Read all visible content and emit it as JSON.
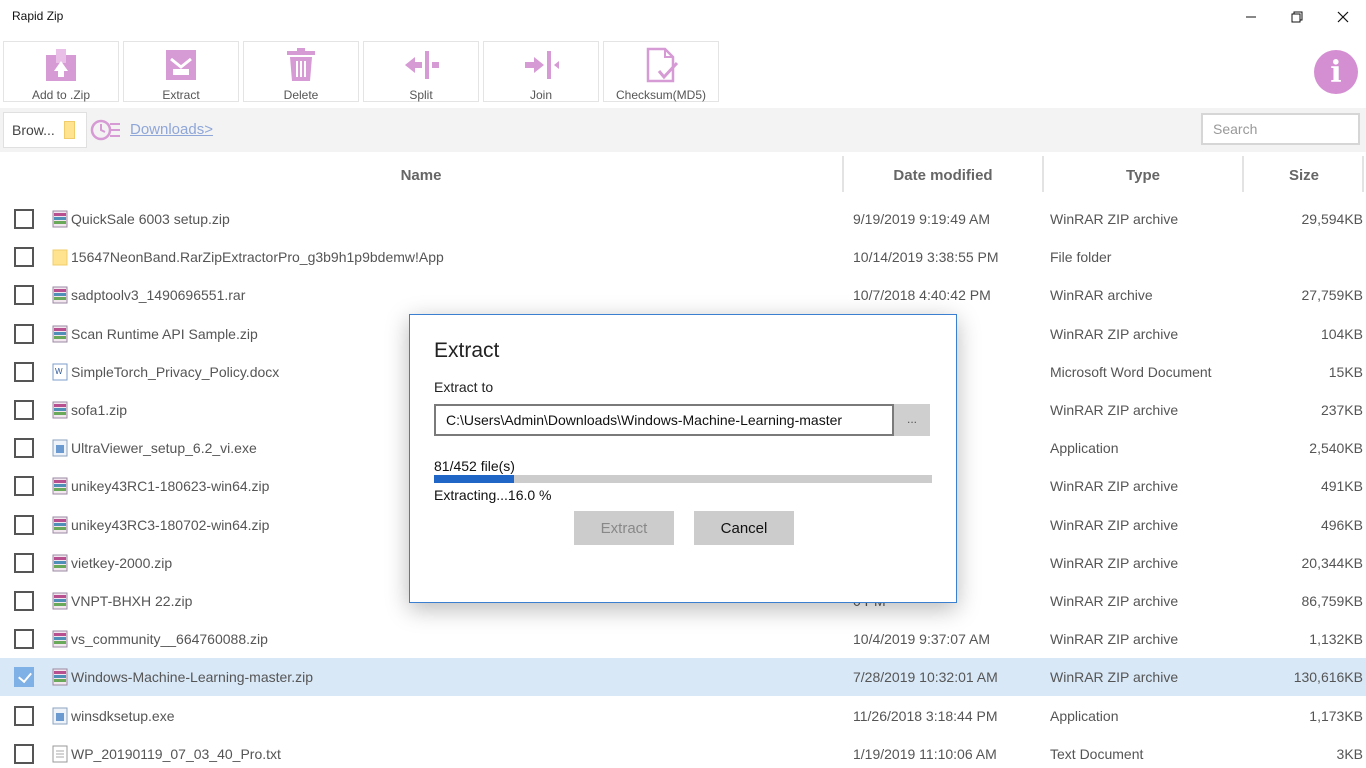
{
  "window": {
    "title": "Rapid Zip"
  },
  "toolbar": {
    "buttons": [
      {
        "label": "Add to .Zip",
        "icon": "add-to-zip-icon"
      },
      {
        "label": "Extract",
        "icon": "extract-icon"
      },
      {
        "label": "Delete",
        "icon": "trash-icon"
      },
      {
        "label": "Split",
        "icon": "split-icon"
      },
      {
        "label": "Join",
        "icon": "join-icon"
      },
      {
        "label": "Checksum(MD5)",
        "icon": "checksum-icon"
      }
    ],
    "info_icon": "i"
  },
  "pathbar": {
    "browse_label": "Brow...",
    "breadcrumb": "Downloads>",
    "search_placeholder": "Search"
  },
  "table": {
    "headers": {
      "name": "Name",
      "date": "Date modified",
      "type": "Type",
      "size": "Size"
    },
    "rows": [
      {
        "name": "QuickSale 6003 setup.zip",
        "date": "9/19/2019 9:19:49 AM",
        "type": "WinRAR ZIP archive",
        "size": "29,594KB",
        "icon": "archive-icon",
        "checked": false
      },
      {
        "name": "15647NeonBand.RarZipExtractorPro_g3b9h1p9bdemw!App",
        "date": "10/14/2019 3:38:55 PM",
        "type": "File folder",
        "size": "",
        "icon": "folder-icon",
        "checked": false
      },
      {
        "name": "sadptoolv3_1490696551.rar",
        "date": "10/7/2018 4:40:42 PM",
        "type": "WinRAR archive",
        "size": "27,759KB",
        "icon": "archive-icon",
        "checked": false
      },
      {
        "name": "Scan Runtime API Sample.zip",
        "date": "8 AM",
        "type": "WinRAR ZIP archive",
        "size": "104KB",
        "icon": "archive-icon",
        "checked": false
      },
      {
        "name": "SimpleTorch_Privacy_Policy.docx",
        "date": "1 PM",
        "type": "Microsoft Word Document",
        "size": "15KB",
        "icon": "word-doc-icon",
        "checked": false
      },
      {
        "name": "sofa1.zip",
        "date": ":48 AM",
        "type": "WinRAR ZIP archive",
        "size": "237KB",
        "icon": "archive-icon",
        "checked": false
      },
      {
        "name": "UltraViewer_setup_6.2_vi.exe",
        "date": "5 PM",
        "type": "Application",
        "size": "2,540KB",
        "icon": "exe-icon",
        "checked": false
      },
      {
        "name": "unikey43RC1-180623-win64.zip",
        "date": "9 PM",
        "type": "WinRAR ZIP archive",
        "size": "491KB",
        "icon": "archive-icon",
        "checked": false
      },
      {
        "name": "unikey43RC3-180702-win64.zip",
        "date": "PM",
        "type": "WinRAR ZIP archive",
        "size": "496KB",
        "icon": "archive-icon",
        "checked": false
      },
      {
        "name": "vietkey-2000.zip",
        "date": "PM",
        "type": "WinRAR ZIP archive",
        "size": "20,344KB",
        "icon": "archive-icon",
        "checked": false
      },
      {
        "name": "VNPT-BHXH 22.zip",
        "date": "0 PM",
        "type": "WinRAR ZIP archive",
        "size": "86,759KB",
        "icon": "archive-icon",
        "checked": false
      },
      {
        "name": "vs_community__664760088.zip",
        "date": "10/4/2019 9:37:07 AM",
        "type": "WinRAR ZIP archive",
        "size": "1,132KB",
        "icon": "archive-icon",
        "checked": false
      },
      {
        "name": "Windows-Machine-Learning-master.zip",
        "date": "7/28/2019 10:32:01 AM",
        "type": "WinRAR ZIP archive",
        "size": "130,616KB",
        "icon": "archive-icon",
        "checked": true
      },
      {
        "name": "winsdksetup.exe",
        "date": "11/26/2018 3:18:44 PM",
        "type": "Application",
        "size": "1,173KB",
        "icon": "exe-icon",
        "checked": false
      },
      {
        "name": "WP_20190119_07_03_40_Pro.txt",
        "date": "1/19/2019 11:10:06 AM",
        "type": "Text Document",
        "size": "3KB",
        "icon": "text-doc-icon",
        "checked": false
      }
    ]
  },
  "dialog": {
    "title": "Extract",
    "extract_to_label": "Extract to",
    "path_value": "C:\\Users\\Admin\\Downloads\\Windows-Machine-Learning-master",
    "browse_label": "...",
    "file_count": "81/452 file(s)",
    "progress_fraction": 0.16,
    "status": "Extracting...16.0 %",
    "extract_button": "Extract",
    "cancel_button": "Cancel"
  },
  "colors": {
    "accent_pink": "#d48fd2",
    "progress_blue": "#1f66c7",
    "selected_row": "#d9e8f7"
  }
}
